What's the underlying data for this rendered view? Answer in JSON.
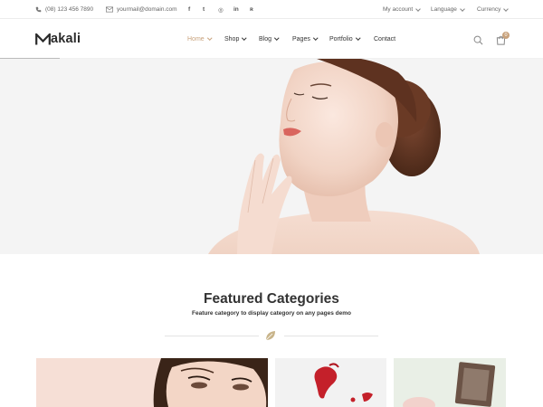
{
  "topbar": {
    "phone": "(08) 123 456 7890",
    "email": "yourmail@domain.com",
    "social": [
      {
        "icon": "facebook-icon",
        "label": "f"
      },
      {
        "icon": "twitter-icon",
        "label": "t"
      },
      {
        "icon": "instagram-icon",
        "label": "◎"
      },
      {
        "icon": "linkedin-icon",
        "label": "in"
      },
      {
        "icon": "rss-icon",
        "label": "ʀ"
      }
    ],
    "my_account": "My account",
    "language": "Language",
    "currency": "Currency"
  },
  "header": {
    "logo": "akali",
    "nav": [
      "Home",
      "Shop",
      "Blog",
      "Pages",
      "Portfolio",
      "Contact"
    ],
    "active_nav": "Home",
    "cart_count": "0",
    "icons": [
      "search-icon",
      "cart-icon"
    ]
  },
  "featured": {
    "title": "Featured Categories",
    "subtitle": "Feature category to display category on any pages demo"
  },
  "colors": {
    "accent": "#c8a27c",
    "hero_bg": "#f4f4f4"
  }
}
